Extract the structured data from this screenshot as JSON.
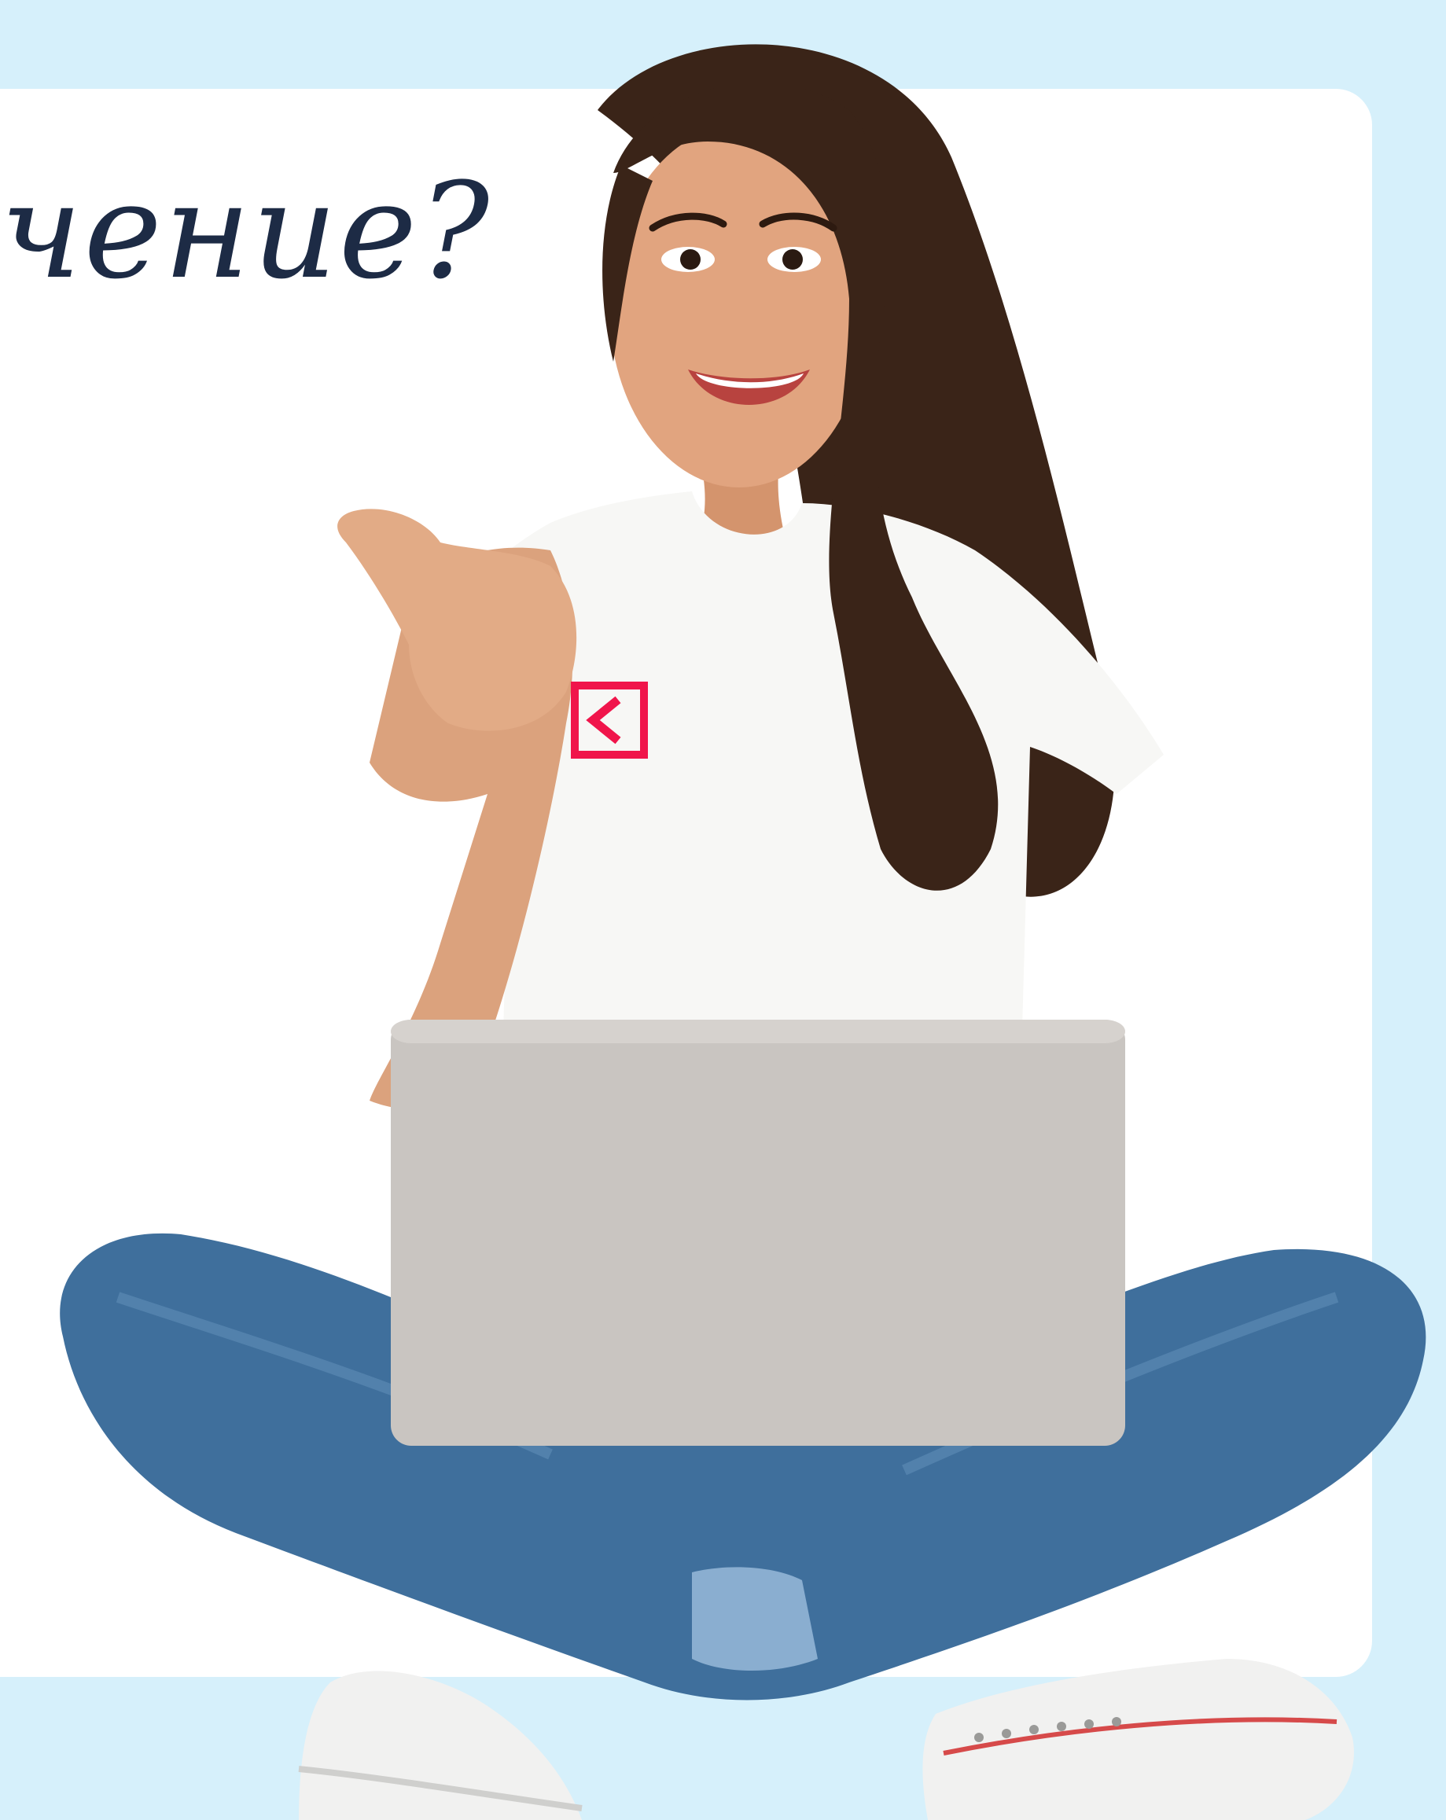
{
  "headline": {
    "text": "чение?"
  },
  "photo": {
    "description_icon": "person-with-laptop-photo",
    "logo_icon": "brand-logo-icon"
  },
  "colors": {
    "background": "#d6f0fb",
    "card": "#ffffff",
    "headline": "#1d2b45",
    "logo": "#f0154b",
    "hair": "#3a2418",
    "skin": "#e1a47f",
    "jeans": "#3f6f9c",
    "laptop": "#c9c5c1"
  }
}
